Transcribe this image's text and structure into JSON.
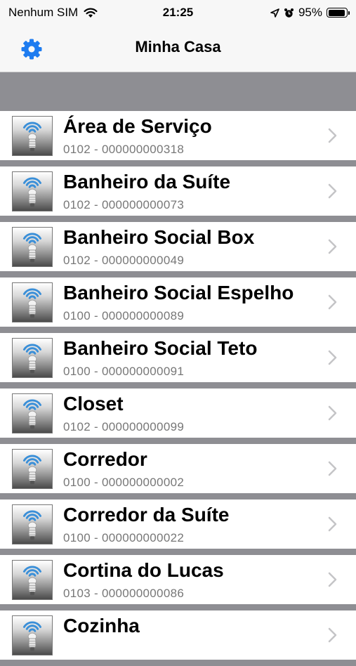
{
  "status_bar": {
    "carrier": "Nenhum SIM",
    "time": "21:25",
    "battery": "95%",
    "battery_level": 0.95
  },
  "nav": {
    "title": "Minha Casa",
    "settings_icon": "gear-icon"
  },
  "colors": {
    "accent": "#1e7cf0",
    "chevron": "#c4c4c7",
    "subtitle": "#777777",
    "separator": "#8e8e93"
  },
  "rooms": [
    {
      "name": "Área de Serviço",
      "code": "0102 - 000000000318"
    },
    {
      "name": "Banheiro da Suíte",
      "code": "0102 - 000000000073"
    },
    {
      "name": "Banheiro Social Box",
      "code": "0102 - 000000000049"
    },
    {
      "name": "Banheiro Social Espelho",
      "code": "0100 - 000000000089"
    },
    {
      "name": "Banheiro Social Teto",
      "code": "0100 - 000000000091"
    },
    {
      "name": "Closet",
      "code": "0102 - 000000000099"
    },
    {
      "name": "Corredor",
      "code": "0100 - 000000000002"
    },
    {
      "name": "Corredor da Suíte",
      "code": "0100 - 000000000022"
    },
    {
      "name": "Cortina do Lucas",
      "code": "0103 - 000000000086"
    },
    {
      "name": "Cozinha",
      "code": ""
    }
  ]
}
